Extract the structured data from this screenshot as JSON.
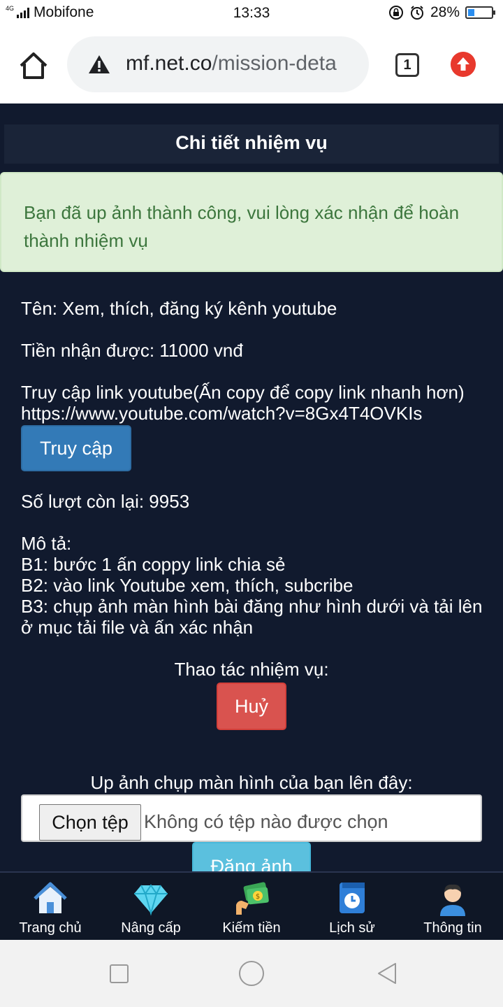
{
  "status_bar": {
    "network": "4G",
    "carrier": "Mobifone",
    "time": "13:33",
    "battery": "28%",
    "battery_level": 0.28
  },
  "browser": {
    "url_domain": "mf.net.co",
    "url_path": "/mission-deta",
    "tab_count": "1",
    "icons": [
      "home-icon",
      "warning-icon",
      "tabs-icon",
      "update-icon"
    ]
  },
  "page": {
    "title": "Chi tiết nhiệm vụ",
    "alert": "Bạn đã up ảnh thành công, vui lòng xác nhận để hoàn thành nhiệm vụ",
    "name_line": "Tên: Xem, thích, đăng ký kênh youtube",
    "reward_line": "Tiền nhận được: 11000 vnđ",
    "access_intro": "Truy cập link youtube(Ấn copy để copy link nhanh hơn)",
    "link": "https://www.youtube.com/watch?v=8Gx4T4OVKIs",
    "access_button": "Truy cập",
    "remaining_line": "Số lượt còn lại: 9953",
    "desc_title": "Mô tả:",
    "step1": "B1: bước 1 ấn coppy link chia sẻ",
    "step2": "B2: vào link Youtube xem, thích, subcribe",
    "step3": "B3: chụp ảnh màn hình bài đăng như hình dưới và tải lên ở mục tải file và ấn xác nhận",
    "actions_label": "Thao tác nhiệm vụ:",
    "cancel_button": "Huỷ",
    "upload_label": "Up ảnh chụp màn hình của bạn lên đây:",
    "choose_file": "Chọn tệp",
    "no_file": "Không có tệp nào được chọn",
    "upload_button": "Đăng ảnh"
  },
  "bottom_nav": {
    "items": [
      {
        "label": "Trang chủ",
        "icon": "house-icon"
      },
      {
        "label": "Nâng cấp",
        "icon": "diamond-icon"
      },
      {
        "label": "Kiếm tiền",
        "icon": "money-icon"
      },
      {
        "label": "Lịch sử",
        "icon": "clock-book-icon"
      },
      {
        "label": "Thông tin",
        "icon": "user-icon"
      }
    ]
  },
  "colors": {
    "page_bg": "#111a2e",
    "alert_bg": "#dff0d8",
    "alert_text": "#3c763d",
    "primary": "#337ab7",
    "danger": "#d9534f",
    "info": "#5bc0de"
  }
}
